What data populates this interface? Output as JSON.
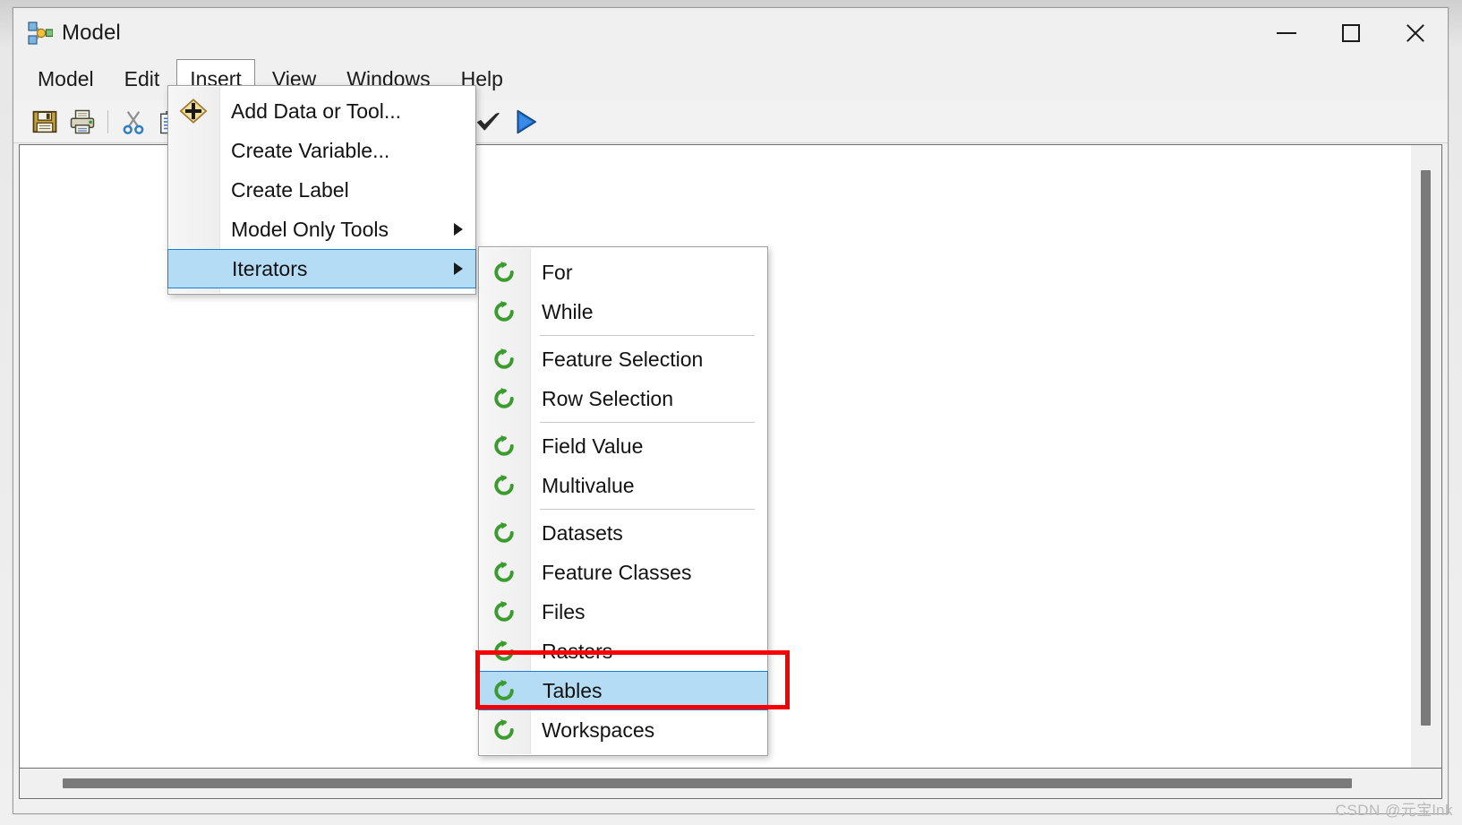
{
  "window": {
    "title": "Model",
    "icon": "model-builder-icon",
    "controls": {
      "minimize": "minimize-icon",
      "maximize": "maximize-icon",
      "close": "close-icon"
    }
  },
  "menubar": {
    "items": [
      {
        "label": "Model",
        "open": false
      },
      {
        "label": "Edit",
        "open": false
      },
      {
        "label": "Insert",
        "open": true
      },
      {
        "label": "View",
        "open": false
      },
      {
        "label": "Windows",
        "open": false
      },
      {
        "label": "Help",
        "open": false
      }
    ]
  },
  "toolbar": {
    "buttons": [
      {
        "icon": "save-icon"
      },
      {
        "icon": "print-icon"
      },
      {
        "sep": true
      },
      {
        "icon": "cut-icon"
      },
      {
        "icon": "copy-icon"
      },
      {
        "sep": true
      },
      {
        "icon": "zoom-to-selection-icon"
      },
      {
        "icon": "full-extent-icon"
      },
      {
        "sep": true
      },
      {
        "icon": "zoom-in-icon"
      },
      {
        "icon": "pan-hand-icon"
      },
      {
        "sep": true
      },
      {
        "icon": "select-arrow-icon"
      },
      {
        "icon": "connect-tool-icon"
      },
      {
        "sep": true
      },
      {
        "icon": "validate-check-icon"
      },
      {
        "icon": "run-play-icon"
      }
    ]
  },
  "insert_menu": {
    "items": [
      {
        "label": "Add Data or Tool...",
        "icon": "add-data-diamond-icon",
        "submenu": false,
        "selected": false
      },
      {
        "label": "Create Variable...",
        "icon": "",
        "submenu": false,
        "selected": false
      },
      {
        "label": "Create Label",
        "icon": "",
        "submenu": false,
        "selected": false
      },
      {
        "label": "Model Only Tools",
        "icon": "",
        "submenu": true,
        "selected": false
      },
      {
        "label": "Iterators",
        "icon": "",
        "submenu": true,
        "selected": true
      }
    ]
  },
  "iterators_menu": {
    "items": [
      {
        "label": "For",
        "icon": "iterator-loop-icon",
        "selected": false,
        "sep_after": false
      },
      {
        "label": "While",
        "icon": "iterator-loop-icon",
        "selected": false,
        "sep_after": true
      },
      {
        "label": "Feature Selection",
        "icon": "iterator-loop-icon",
        "selected": false,
        "sep_after": false
      },
      {
        "label": "Row Selection",
        "icon": "iterator-loop-icon",
        "selected": false,
        "sep_after": true
      },
      {
        "label": "Field Value",
        "icon": "iterator-loop-icon",
        "selected": false,
        "sep_after": false
      },
      {
        "label": "Multivalue",
        "icon": "iterator-loop-icon",
        "selected": false,
        "sep_after": true
      },
      {
        "label": "Datasets",
        "icon": "iterator-loop-icon",
        "selected": false,
        "sep_after": false
      },
      {
        "label": "Feature Classes",
        "icon": "iterator-loop-icon",
        "selected": false,
        "sep_after": false
      },
      {
        "label": "Files",
        "icon": "iterator-loop-icon",
        "selected": false,
        "sep_after": false
      },
      {
        "label": "Rasters",
        "icon": "iterator-loop-icon",
        "selected": false,
        "sep_after": false
      },
      {
        "label": "Tables",
        "icon": "iterator-loop-icon",
        "selected": true,
        "sep_after": false
      },
      {
        "label": "Workspaces",
        "icon": "iterator-loop-icon",
        "selected": false,
        "sep_after": false
      }
    ]
  },
  "annotation": {
    "type": "red-rectangle",
    "target": "Tables",
    "color": "#f90000"
  },
  "watermark": {
    "text": "CSDN @元宝lnk"
  },
  "colors": {
    "menu_highlight": "#b5dcf5",
    "menu_highlight_border": "#1a7fd4",
    "annotation_red": "#f90000",
    "iterator_green": "#3b9b2f",
    "window_chrome": "#f0f0f0"
  }
}
